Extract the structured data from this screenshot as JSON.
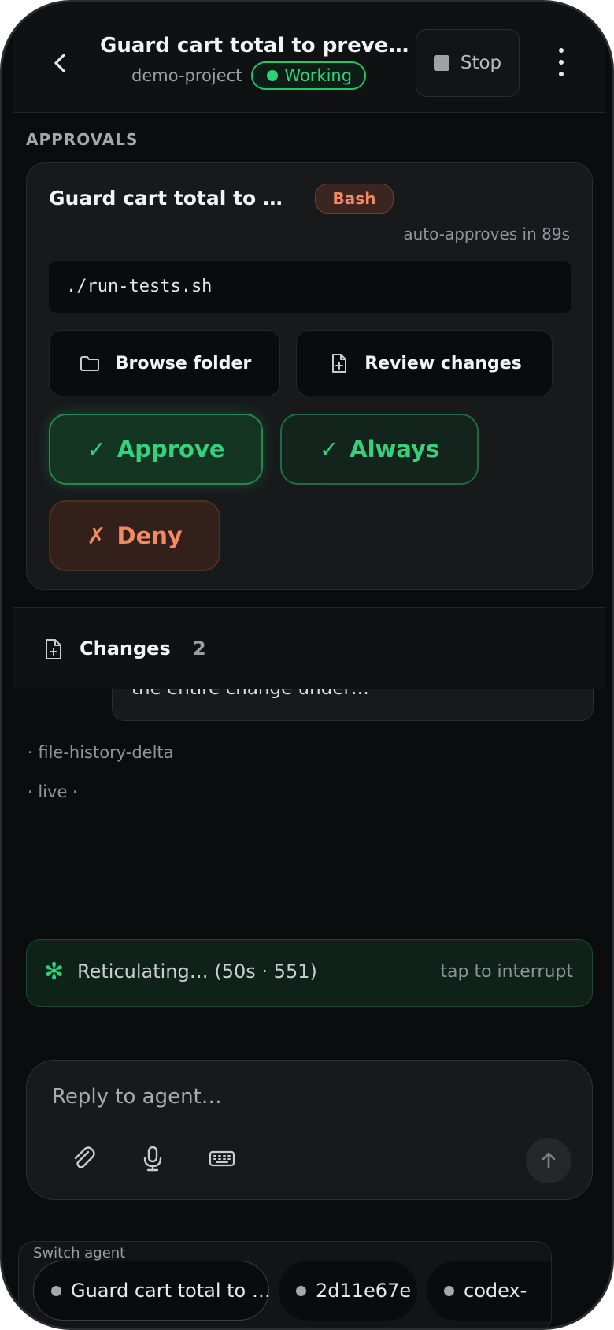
{
  "header": {
    "title": "Guard cart total to preve…",
    "project": "demo-project",
    "status": "Working",
    "stop_label": "Stop"
  },
  "approvals": {
    "section_label": "APPROVALS",
    "card": {
      "title": "Guard cart total to …",
      "tool_badge": "Bash",
      "auto_approve": "auto-approves in 89s",
      "command": "./run-tests.sh",
      "browse_label": "Browse folder",
      "review_label": "Review changes",
      "approve_label": "Approve",
      "always_label": "Always",
      "deny_label": "Deny",
      "check_glyph": "✓",
      "cross_glyph": "✗"
    }
  },
  "changes": {
    "label": "Changes",
    "count": "2"
  },
  "chat": {
    "bubble_text": "the entire change under…",
    "meta_lines": [
      "· file-history-delta",
      "· live ·"
    ]
  },
  "status": {
    "spinner_glyph": "✻",
    "text": "Reticulating… (50s · 551)",
    "interrupt": "tap to interrupt"
  },
  "composer": {
    "placeholder": "Reply to agent…",
    "icons": [
      "paperclip-icon",
      "microphone-icon",
      "keyboard-icon",
      "arrow-up-icon"
    ]
  },
  "switcher": {
    "label": "Switch agent",
    "agents": [
      "Guard cart total to …",
      "2d11e67e",
      "codex-"
    ]
  },
  "colors": {
    "background": "#0b0c0e",
    "accent_green": "#2ed27a",
    "deny_orange": "#f08b65"
  }
}
